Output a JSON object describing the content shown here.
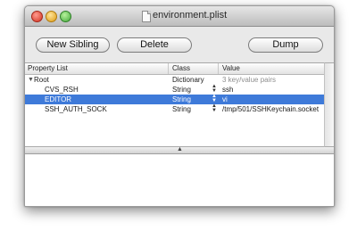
{
  "window": {
    "title": "environment.plist"
  },
  "toolbar": {
    "new_sibling_label": "New Sibling",
    "delete_label": "Delete",
    "dump_label": "Dump"
  },
  "table": {
    "columns": [
      "Property List",
      "Class",
      "Value"
    ],
    "rows": [
      {
        "key": "Root",
        "class": "Dictionary",
        "value": "3 key/value pairs",
        "expanded": true
      },
      {
        "key": "CVS_RSH",
        "class": "String",
        "value": "ssh"
      },
      {
        "key": "EDITOR",
        "class": "String",
        "value": "vi",
        "selected": true
      },
      {
        "key": "SSH_AUTH_SOCK",
        "class": "String",
        "value": "/tmp/501/SSHKeychain.socket"
      }
    ]
  },
  "icons": {
    "disclosure": "▼",
    "stepper": "▲▼",
    "split_grip": "▲"
  },
  "colors": {
    "selection": "#3e7ad9",
    "close": "#d2311f",
    "minimize": "#dd9b12",
    "zoom": "#43a83a"
  }
}
